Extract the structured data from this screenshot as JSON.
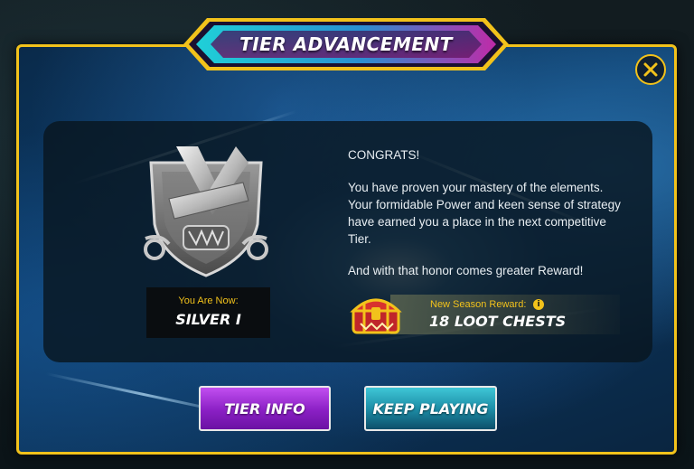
{
  "modal": {
    "title": "TIER ADVANCEMENT",
    "close_icon": "close-x-icon"
  },
  "rank": {
    "caption": "You Are Now:",
    "name": "SILVER I",
    "badge_icon": "silver-tier-badge-icon"
  },
  "message": {
    "line_congrats": "CONGRATS!",
    "paragraph_1": "You have proven your mastery of the elements. Your formidable Power and keen sense of strategy have earned you a place in the next competitive Tier.",
    "paragraph_2": "And with that honor comes greater Reward!"
  },
  "reward": {
    "label": "New Season Reward:",
    "value": "18 LOOT CHESTS",
    "chest_icon": "loot-chest-icon",
    "info_icon": "info-icon",
    "info_glyph": "i"
  },
  "buttons": {
    "tier_info": "TIER INFO",
    "keep_playing": "KEEP PLAYING"
  },
  "colors": {
    "accent_gold": "#f2c21b",
    "button_purple": "#8a1fc4",
    "button_teal": "#1d8fa8"
  }
}
